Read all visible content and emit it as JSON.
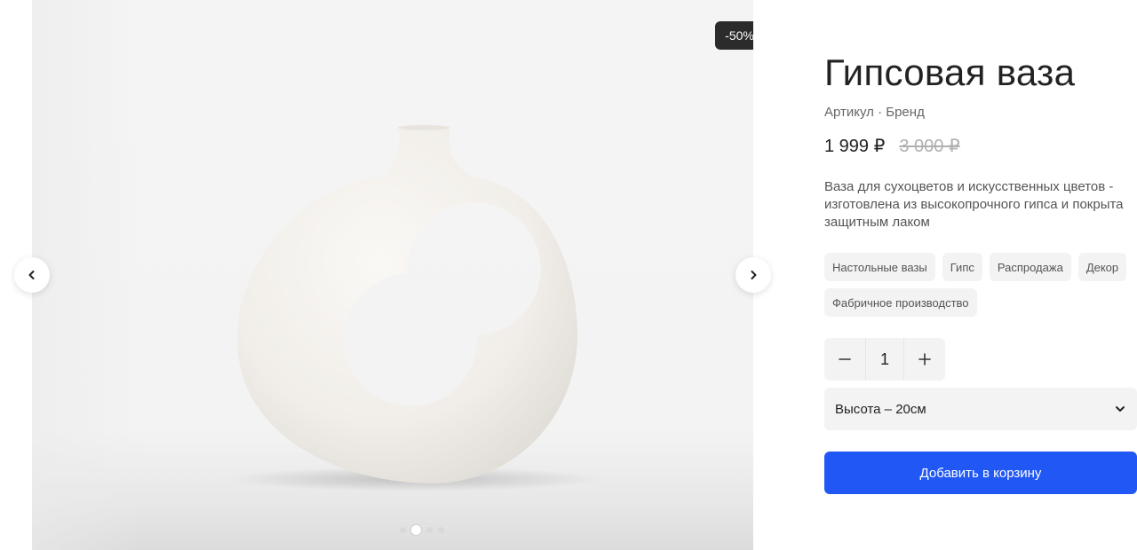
{
  "product": {
    "title": "Гипсовая ваза",
    "meta": "Артикул · Бренд",
    "price": "1 999 ₽",
    "old_price": "3 000 ₽",
    "discount_badge": "-50%",
    "description": "Ваза для сухоцветов и искусственных цветов - изготовлена из высокопрочного гипса и покрыта защитным лаком"
  },
  "tags": [
    "Настольные вазы",
    "Гипс",
    "Распродажа",
    "Декор",
    "Фабричное производство"
  ],
  "quantity": {
    "value": "1",
    "minus_icon": "minus-icon",
    "plus_icon": "plus-icon"
  },
  "variant_select": {
    "selected": "Высота – 20см",
    "icon": "chevron-down-icon"
  },
  "cart_button": {
    "label": "Добавить в корзину",
    "color": "#2057f5"
  },
  "gallery": {
    "image": "white-donut-vase-photo",
    "prev_icon": "chevron-left-icon",
    "next_icon": "chevron-right-icon",
    "slide_count": 4,
    "active_slide": 2
  }
}
